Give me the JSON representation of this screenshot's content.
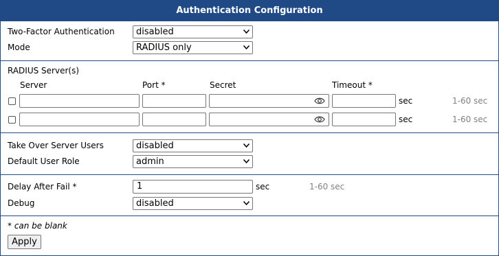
{
  "title": "Authentication Configuration",
  "two_factor": {
    "label": "Two-Factor Authentication",
    "value": "disabled"
  },
  "mode": {
    "label": "Mode",
    "value": "RADIUS only"
  },
  "radius": {
    "section_label": "RADIUS Server(s)",
    "columns": {
      "server": "Server",
      "port": "Port *",
      "secret": "Secret",
      "timeout": "Timeout *"
    },
    "rows": [
      {
        "server": "",
        "port": "",
        "secret": "",
        "timeout": "",
        "unit": "sec",
        "hint": "1-60 sec"
      },
      {
        "server": "",
        "port": "",
        "secret": "",
        "timeout": "",
        "unit": "sec",
        "hint": "1-60 sec"
      }
    ]
  },
  "take_over": {
    "label": "Take Over Server Users",
    "value": "disabled"
  },
  "default_role": {
    "label": "Default User Role",
    "value": "admin"
  },
  "delay": {
    "label": "Delay After Fail *",
    "value": "1",
    "unit": "sec",
    "hint": "1-60 sec"
  },
  "debug": {
    "label": "Debug",
    "value": "disabled"
  },
  "note": "* can be blank",
  "apply_label": "Apply",
  "colors": {
    "header_bg": "#1f4a86",
    "hint": "#808080"
  },
  "icons": {
    "select_arrow": "chevron-down-icon",
    "secret_toggle": "eye-icon"
  }
}
